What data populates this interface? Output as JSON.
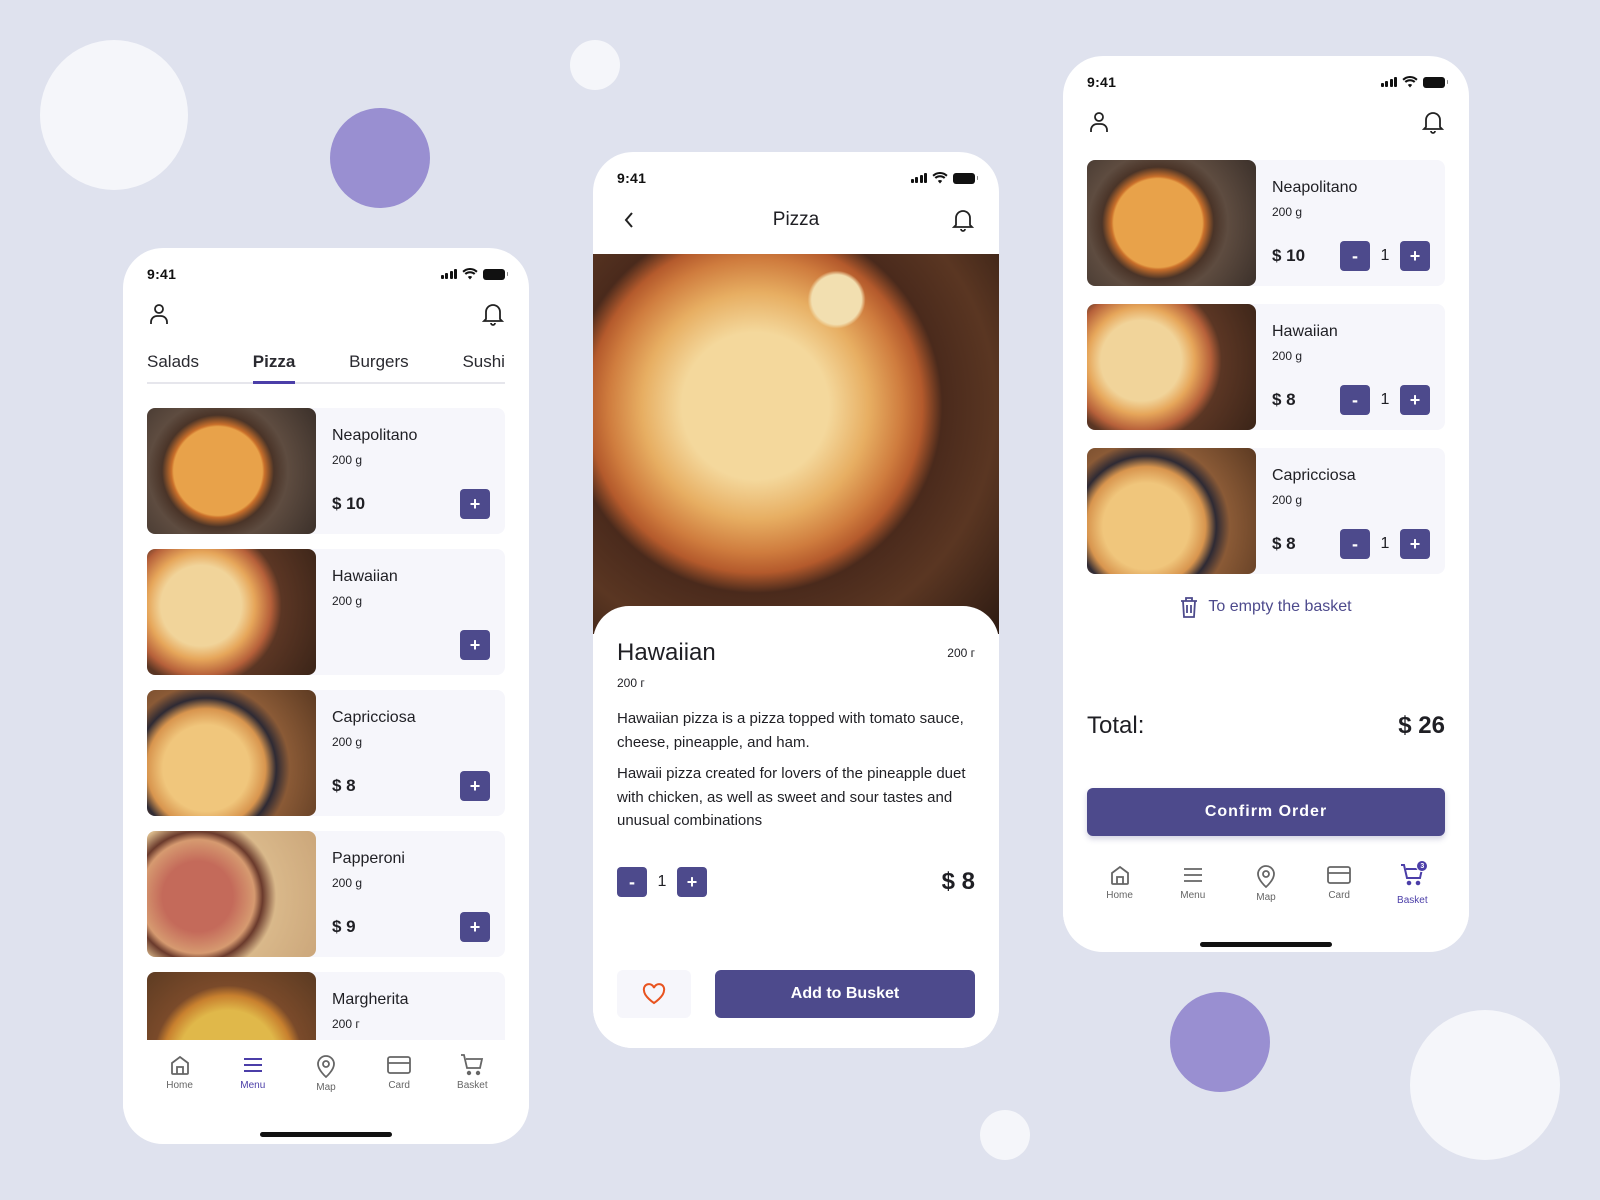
{
  "colors": {
    "background": "#dfe2ee",
    "accent": "#4d4a8c",
    "active_tab": "#4b3ea8",
    "card_bg": "#f6f6fb",
    "heart": "#e8531f",
    "bubble_purple": "#998fd1",
    "bubble_light": "#f5f6fa"
  },
  "menu_screen": {
    "status_time": "9:41",
    "tabs": [
      {
        "label": "Salads",
        "active": false
      },
      {
        "label": "Pizza",
        "active": true
      },
      {
        "label": "Burgers",
        "active": false
      },
      {
        "label": "Sushi",
        "active": false
      }
    ],
    "products": [
      {
        "name": "Neapolitano",
        "weight": "200 g",
        "price": "$ 10",
        "add_label": "+"
      },
      {
        "name": "Hawaiian",
        "weight": "200 g",
        "price": "",
        "add_label": "+"
      },
      {
        "name": "Capricciosa",
        "weight": "200 g",
        "price": "$ 8",
        "add_label": "+"
      },
      {
        "name": "Papperoni",
        "weight": "200 g",
        "price": "$ 9",
        "add_label": "+"
      },
      {
        "name": "Margherita",
        "weight": "200 г",
        "price": ""
      }
    ],
    "nav": [
      {
        "label": "Home",
        "icon": "home-icon",
        "active": false
      },
      {
        "label": "Menu",
        "icon": "menu-icon",
        "active": true
      },
      {
        "label": "Map",
        "icon": "map-pin-icon",
        "active": false
      },
      {
        "label": "Card",
        "icon": "credit-card-icon",
        "active": false
      },
      {
        "label": "Basket",
        "icon": "cart-icon",
        "active": false
      }
    ]
  },
  "detail_screen": {
    "status_time": "9:41",
    "title": "Pizza",
    "product_name": "Hawaiian",
    "weight_right": "200 г",
    "weight": "200 г",
    "description_1": "Hawaiian pizza is a pizza topped with tomato sauce, cheese, pineapple, and ham.",
    "description_2": "Hawaii pizza created for lovers of the pineapple duet with chicken, as well as sweet and sour tastes and unusual combinations",
    "minus_label": "-",
    "plus_label": "+",
    "quantity": "1",
    "price": "$ 8",
    "add_button": "Add to Busket"
  },
  "basket_screen": {
    "status_time": "9:41",
    "items": [
      {
        "name": "Neapolitano",
        "weight": "200 g",
        "price": "$ 10",
        "quantity": "1"
      },
      {
        "name": "Hawaiian",
        "weight": "200 g",
        "price": "$ 8",
        "quantity": "1"
      },
      {
        "name": "Capricciosa",
        "weight": "200 g",
        "price": "$ 8",
        "quantity": "1"
      }
    ],
    "minus_label": "-",
    "plus_label": "+",
    "empty_basket": "To empty the basket",
    "total_label": "Total:",
    "total_value": "$ 26",
    "confirm_button": "Confirm Order",
    "basket_badge": "3",
    "nav": [
      {
        "label": "Home",
        "icon": "home-icon",
        "active": false
      },
      {
        "label": "Menu",
        "icon": "menu-icon",
        "active": false
      },
      {
        "label": "Map",
        "icon": "map-pin-icon",
        "active": false
      },
      {
        "label": "Card",
        "icon": "credit-card-icon",
        "active": false
      },
      {
        "label": "Basket",
        "icon": "cart-icon",
        "active": true
      }
    ]
  }
}
